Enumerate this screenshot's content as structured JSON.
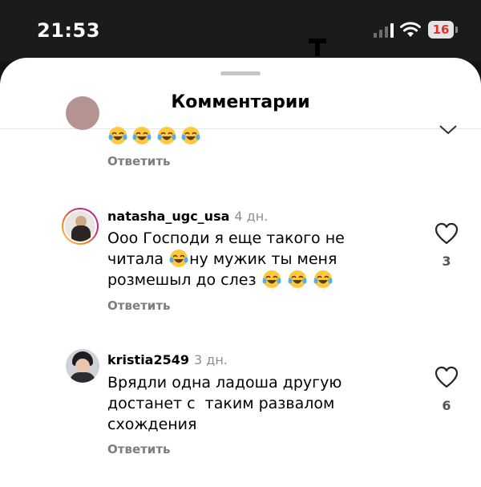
{
  "status_bar": {
    "time": "21:53",
    "battery_level": "16",
    "battery_color": "#e8302a"
  },
  "sheet": {
    "title": "Комментарии"
  },
  "comments": [
    {
      "username": "",
      "time": "",
      "text_emojis": 4,
      "reply_label": "Ответить",
      "likes": ""
    },
    {
      "username": "natasha_ugc_usa",
      "time": "4 дн.",
      "text_line1": "Ооо Господи я еще такого не",
      "text_line2a": "читала",
      "text_line2b": "ну мужик ты меня",
      "text_line3": "розмешыл до слез",
      "reply_label": "Ответить",
      "likes": "3"
    },
    {
      "username": "kristia2549",
      "time": "3 дн.",
      "text_line1": "Врядли одна ладоша другую",
      "text_line2": "достанет с  таким развалом",
      "text_line3": "схождения",
      "reply_label": "Ответить",
      "likes": "6"
    }
  ],
  "icons": {
    "emoji": "laughing-tears-emoji",
    "like": "heart-outline-icon"
  }
}
